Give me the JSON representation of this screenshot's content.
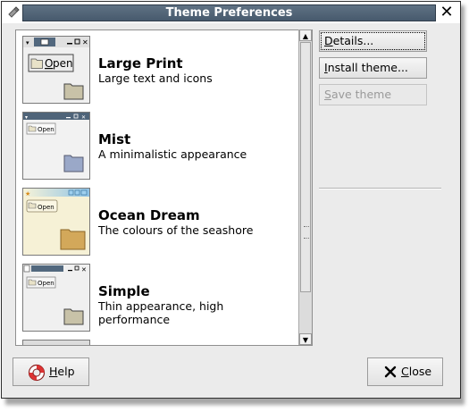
{
  "window": {
    "title": "Theme Preferences",
    "close_glyph": "✕"
  },
  "themes": [
    {
      "name": "Large Print",
      "description": "Large text and icons",
      "preview_button": "Open"
    },
    {
      "name": "Mist",
      "description": "A minimalistic appearance",
      "preview_button": "Open"
    },
    {
      "name": "Ocean Dream",
      "description": "The colours of the seashore",
      "preview_button": "Open"
    },
    {
      "name": "Simple",
      "description": "Thin appearance, high performance",
      "preview_button": "Open"
    }
  ],
  "actions": {
    "details_first": "D",
    "details_rest": "etails...",
    "install_first": "I",
    "install_rest": "nstall theme...",
    "save_first": "S",
    "save_rest": "ave theme"
  },
  "footer": {
    "help_first": "H",
    "help_rest": "elp",
    "close_first": "C",
    "close_rest": "lose"
  },
  "colors": {
    "titlebar": "#5f7183",
    "window_bg": "#ebebeb",
    "list_bg": "#ffffff",
    "disabled_text": "#9a9a9a"
  }
}
